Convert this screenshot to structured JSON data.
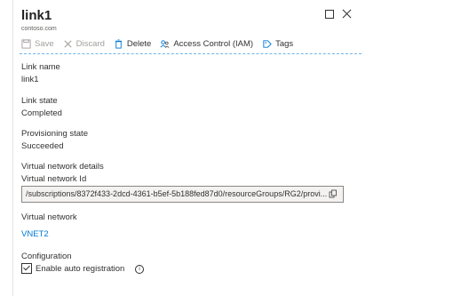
{
  "header": {
    "title": "link1",
    "subtitle": "contoso.com"
  },
  "toolbar": {
    "save_label": "Save",
    "discard_label": "Discard",
    "delete_label": "Delete",
    "access_label": "Access Control (IAM)",
    "tags_label": "Tags"
  },
  "fields": {
    "link_name_label": "Link name",
    "link_name_value": "link1",
    "link_state_label": "Link state",
    "link_state_value": "Completed",
    "prov_state_label": "Provisioning state",
    "prov_state_value": "Succeeded"
  },
  "vnet_details": {
    "heading": "Virtual network details",
    "id_label": "Virtual network Id",
    "id_value": "/subscriptions/8372f433-2dcd-4361-b5ef-5b188fed87d0/resourceGroups/RG2/provi...",
    "vnet_label": "Virtual network",
    "vnet_value": "VNET2"
  },
  "configuration": {
    "heading": "Configuration",
    "auto_registration_label": "Enable auto registration",
    "auto_registration_checked": true
  },
  "colors": {
    "accent": "#0078d4",
    "text": "#323130",
    "disabled": "#a19f9d"
  }
}
